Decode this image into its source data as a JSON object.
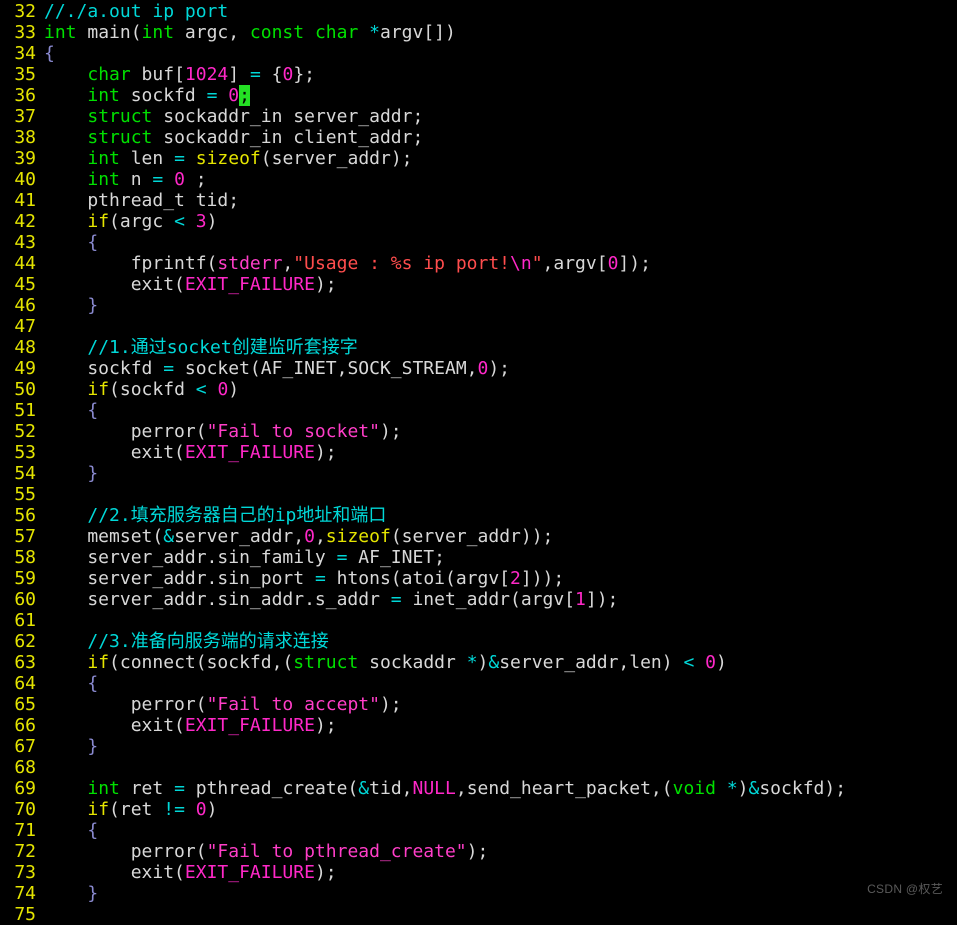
{
  "editor": {
    "background_color": "#000000",
    "default_text_color": "#d8d8d8",
    "gutter_color": "#e5e500",
    "cursor_color": "#24e024",
    "first_line_number": 32,
    "last_line_number": 75,
    "language": "C",
    "colors": {
      "comment": "#00d8d8",
      "type_keyword": "#00e000",
      "control_keyword": "#e5e500",
      "number": "#ff28c8",
      "string": "#ff4d4d",
      "string_alt": "#ff3ec8",
      "macro": "#ff28c8",
      "operator": "#00d8d8",
      "identifier": "#d8d8d8",
      "brace": "#8a8ad0",
      "watermark": "#5a5a5a"
    }
  },
  "watermark": {
    "text": "CSDN @权艺"
  },
  "lines": [
    {
      "num": "32",
      "tokens": [
        {
          "t": "//./a.out ip port",
          "c": "t-cmt"
        }
      ]
    },
    {
      "num": "33",
      "tokens": [
        {
          "t": "int",
          "c": "t-kw"
        },
        {
          "t": " main",
          "c": "t-id"
        },
        {
          "t": "(",
          "c": "t-punc"
        },
        {
          "t": "int",
          "c": "t-kw"
        },
        {
          "t": " argc, ",
          "c": "t-id"
        },
        {
          "t": "const",
          "c": "t-kw"
        },
        {
          "t": " ",
          "c": "t-id"
        },
        {
          "t": "char",
          "c": "t-kw"
        },
        {
          "t": " ",
          "c": "t-id"
        },
        {
          "t": "*",
          "c": "t-op"
        },
        {
          "t": "argv[])",
          "c": "t-id"
        }
      ]
    },
    {
      "num": "34",
      "tokens": [
        {
          "t": "{",
          "c": "t-brace"
        }
      ]
    },
    {
      "num": "35",
      "tokens": [
        {
          "t": "    ",
          "c": "t-id"
        },
        {
          "t": "char",
          "c": "t-kw"
        },
        {
          "t": " buf[",
          "c": "t-id"
        },
        {
          "t": "1024",
          "c": "t-num"
        },
        {
          "t": "] ",
          "c": "t-id"
        },
        {
          "t": "=",
          "c": "t-op"
        },
        {
          "t": " {",
          "c": "t-id"
        },
        {
          "t": "0",
          "c": "t-num"
        },
        {
          "t": "};",
          "c": "t-id"
        }
      ]
    },
    {
      "num": "36",
      "tokens": [
        {
          "t": "    ",
          "c": "t-id"
        },
        {
          "t": "int",
          "c": "t-kw"
        },
        {
          "t": " sockfd ",
          "c": "t-id"
        },
        {
          "t": "=",
          "c": "t-op"
        },
        {
          "t": " ",
          "c": "t-id"
        },
        {
          "t": "0",
          "c": "t-num"
        },
        {
          "t": ";",
          "c": "cursor"
        }
      ]
    },
    {
      "num": "37",
      "tokens": [
        {
          "t": "    ",
          "c": "t-id"
        },
        {
          "t": "struct",
          "c": "t-kw"
        },
        {
          "t": " sockaddr_in server_addr;",
          "c": "t-id"
        }
      ]
    },
    {
      "num": "38",
      "tokens": [
        {
          "t": "    ",
          "c": "t-id"
        },
        {
          "t": "struct",
          "c": "t-kw"
        },
        {
          "t": " sockaddr_in client_addr;",
          "c": "t-id"
        }
      ]
    },
    {
      "num": "39",
      "tokens": [
        {
          "t": "    ",
          "c": "t-id"
        },
        {
          "t": "int",
          "c": "t-kw"
        },
        {
          "t": " len ",
          "c": "t-id"
        },
        {
          "t": "=",
          "c": "t-op"
        },
        {
          "t": " ",
          "c": "t-id"
        },
        {
          "t": "sizeof",
          "c": "t-ctl"
        },
        {
          "t": "(server_addr);",
          "c": "t-id"
        }
      ]
    },
    {
      "num": "40",
      "tokens": [
        {
          "t": "    ",
          "c": "t-id"
        },
        {
          "t": "int",
          "c": "t-kw"
        },
        {
          "t": " n ",
          "c": "t-id"
        },
        {
          "t": "=",
          "c": "t-op"
        },
        {
          "t": " ",
          "c": "t-id"
        },
        {
          "t": "0",
          "c": "t-num"
        },
        {
          "t": " ;",
          "c": "t-id"
        }
      ]
    },
    {
      "num": "41",
      "tokens": [
        {
          "t": "    pthread_t tid;",
          "c": "t-id"
        }
      ]
    },
    {
      "num": "42",
      "tokens": [
        {
          "t": "    ",
          "c": "t-id"
        },
        {
          "t": "if",
          "c": "t-ctl"
        },
        {
          "t": "(argc ",
          "c": "t-id"
        },
        {
          "t": "<",
          "c": "t-op"
        },
        {
          "t": " ",
          "c": "t-id"
        },
        {
          "t": "3",
          "c": "t-num"
        },
        {
          "t": ")",
          "c": "t-id"
        }
      ]
    },
    {
      "num": "43",
      "tokens": [
        {
          "t": "    {",
          "c": "t-brace"
        }
      ]
    },
    {
      "num": "44",
      "tokens": [
        {
          "t": "        fprintf(",
          "c": "t-id"
        },
        {
          "t": "stderr",
          "c": "t-str2"
        },
        {
          "t": ",",
          "c": "t-id"
        },
        {
          "t": "\"Usage : %s ip port!",
          "c": "t-str"
        },
        {
          "t": "\\n",
          "c": "t-esc"
        },
        {
          "t": "\"",
          "c": "t-str"
        },
        {
          "t": ",argv[",
          "c": "t-id"
        },
        {
          "t": "0",
          "c": "t-num"
        },
        {
          "t": "]);",
          "c": "t-id"
        }
      ]
    },
    {
      "num": "45",
      "tokens": [
        {
          "t": "        exit(",
          "c": "t-id"
        },
        {
          "t": "EXIT_FAILURE",
          "c": "t-mac"
        },
        {
          "t": ");",
          "c": "t-id"
        }
      ]
    },
    {
      "num": "46",
      "tokens": [
        {
          "t": "    }",
          "c": "t-brace"
        }
      ]
    },
    {
      "num": "47",
      "tokens": []
    },
    {
      "num": "48",
      "tokens": [
        {
          "t": "    ",
          "c": "t-id"
        },
        {
          "t": "//1.通过socket创建监听套接字",
          "c": "t-cmt"
        }
      ]
    },
    {
      "num": "49",
      "tokens": [
        {
          "t": "    sockfd ",
          "c": "t-id"
        },
        {
          "t": "=",
          "c": "t-op"
        },
        {
          "t": " socket(AF_INET,SOCK_STREAM,",
          "c": "t-id"
        },
        {
          "t": "0",
          "c": "t-num"
        },
        {
          "t": ");",
          "c": "t-id"
        }
      ]
    },
    {
      "num": "50",
      "tokens": [
        {
          "t": "    ",
          "c": "t-id"
        },
        {
          "t": "if",
          "c": "t-ctl"
        },
        {
          "t": "(sockfd ",
          "c": "t-id"
        },
        {
          "t": "<",
          "c": "t-op"
        },
        {
          "t": " ",
          "c": "t-id"
        },
        {
          "t": "0",
          "c": "t-num"
        },
        {
          "t": ")",
          "c": "t-id"
        }
      ]
    },
    {
      "num": "51",
      "tokens": [
        {
          "t": "    {",
          "c": "t-brace"
        }
      ]
    },
    {
      "num": "52",
      "tokens": [
        {
          "t": "        perror(",
          "c": "t-id"
        },
        {
          "t": "\"Fail to socket\"",
          "c": "t-str2"
        },
        {
          "t": ");",
          "c": "t-id"
        }
      ]
    },
    {
      "num": "53",
      "tokens": [
        {
          "t": "        exit(",
          "c": "t-id"
        },
        {
          "t": "EXIT_FAILURE",
          "c": "t-mac"
        },
        {
          "t": ");",
          "c": "t-id"
        }
      ]
    },
    {
      "num": "54",
      "tokens": [
        {
          "t": "    }",
          "c": "t-brace"
        }
      ]
    },
    {
      "num": "55",
      "tokens": []
    },
    {
      "num": "56",
      "tokens": [
        {
          "t": "    ",
          "c": "t-id"
        },
        {
          "t": "//2.填充服务器自己的ip地址和端口",
          "c": "t-cmt"
        }
      ]
    },
    {
      "num": "57",
      "tokens": [
        {
          "t": "    memset(",
          "c": "t-id"
        },
        {
          "t": "&",
          "c": "t-op"
        },
        {
          "t": "server_addr,",
          "c": "t-id"
        },
        {
          "t": "0",
          "c": "t-num"
        },
        {
          "t": ",",
          "c": "t-id"
        },
        {
          "t": "sizeof",
          "c": "t-ctl"
        },
        {
          "t": "(server_addr));",
          "c": "t-id"
        }
      ]
    },
    {
      "num": "58",
      "tokens": [
        {
          "t": "    server_addr.sin_family ",
          "c": "t-id"
        },
        {
          "t": "=",
          "c": "t-op"
        },
        {
          "t": " AF_INET;",
          "c": "t-id"
        }
      ]
    },
    {
      "num": "59",
      "tokens": [
        {
          "t": "    server_addr.sin_port ",
          "c": "t-id"
        },
        {
          "t": "=",
          "c": "t-op"
        },
        {
          "t": " htons(atoi(argv[",
          "c": "t-id"
        },
        {
          "t": "2",
          "c": "t-num"
        },
        {
          "t": "]));",
          "c": "t-id"
        }
      ]
    },
    {
      "num": "60",
      "tokens": [
        {
          "t": "    server_addr.sin_addr.s_addr ",
          "c": "t-id"
        },
        {
          "t": "=",
          "c": "t-op"
        },
        {
          "t": " inet_addr(argv[",
          "c": "t-id"
        },
        {
          "t": "1",
          "c": "t-num"
        },
        {
          "t": "]);",
          "c": "t-id"
        }
      ]
    },
    {
      "num": "61",
      "tokens": []
    },
    {
      "num": "62",
      "tokens": [
        {
          "t": "    ",
          "c": "t-id"
        },
        {
          "t": "//3.准备向服务端的请求连接",
          "c": "t-cmt"
        }
      ]
    },
    {
      "num": "63",
      "tokens": [
        {
          "t": "    ",
          "c": "t-id"
        },
        {
          "t": "if",
          "c": "t-ctl"
        },
        {
          "t": "(connect(sockfd,(",
          "c": "t-id"
        },
        {
          "t": "struct",
          "c": "t-kw"
        },
        {
          "t": " sockaddr ",
          "c": "t-id"
        },
        {
          "t": "*",
          "c": "t-op"
        },
        {
          "t": ")",
          "c": "t-id"
        },
        {
          "t": "&",
          "c": "t-op"
        },
        {
          "t": "server_addr,len) ",
          "c": "t-id"
        },
        {
          "t": "<",
          "c": "t-op"
        },
        {
          "t": " ",
          "c": "t-id"
        },
        {
          "t": "0",
          "c": "t-num"
        },
        {
          "t": ")",
          "c": "t-id"
        }
      ]
    },
    {
      "num": "64",
      "tokens": [
        {
          "t": "    {",
          "c": "t-brace"
        }
      ]
    },
    {
      "num": "65",
      "tokens": [
        {
          "t": "        perror(",
          "c": "t-id"
        },
        {
          "t": "\"Fail to accept\"",
          "c": "t-str2"
        },
        {
          "t": ");",
          "c": "t-id"
        }
      ]
    },
    {
      "num": "66",
      "tokens": [
        {
          "t": "        exit(",
          "c": "t-id"
        },
        {
          "t": "EXIT_FAILURE",
          "c": "t-mac"
        },
        {
          "t": ");",
          "c": "t-id"
        }
      ]
    },
    {
      "num": "67",
      "tokens": [
        {
          "t": "    }",
          "c": "t-brace"
        }
      ]
    },
    {
      "num": "68",
      "tokens": []
    },
    {
      "num": "69",
      "tokens": [
        {
          "t": "    ",
          "c": "t-id"
        },
        {
          "t": "int",
          "c": "t-kw"
        },
        {
          "t": " ret ",
          "c": "t-id"
        },
        {
          "t": "=",
          "c": "t-op"
        },
        {
          "t": " pthread_create(",
          "c": "t-id"
        },
        {
          "t": "&",
          "c": "t-op"
        },
        {
          "t": "tid,",
          "c": "t-id"
        },
        {
          "t": "NULL",
          "c": "t-mac"
        },
        {
          "t": ",send_heart_packet,(",
          "c": "t-id"
        },
        {
          "t": "void",
          "c": "t-kw"
        },
        {
          "t": " ",
          "c": "t-id"
        },
        {
          "t": "*",
          "c": "t-op"
        },
        {
          "t": ")",
          "c": "t-id"
        },
        {
          "t": "&",
          "c": "t-op"
        },
        {
          "t": "sockfd);",
          "c": "t-id"
        }
      ]
    },
    {
      "num": "70",
      "tokens": [
        {
          "t": "    ",
          "c": "t-id"
        },
        {
          "t": "if",
          "c": "t-ctl"
        },
        {
          "t": "(ret ",
          "c": "t-id"
        },
        {
          "t": "!=",
          "c": "t-op"
        },
        {
          "t": " ",
          "c": "t-id"
        },
        {
          "t": "0",
          "c": "t-num"
        },
        {
          "t": ")",
          "c": "t-id"
        }
      ]
    },
    {
      "num": "71",
      "tokens": [
        {
          "t": "    {",
          "c": "t-brace"
        }
      ]
    },
    {
      "num": "72",
      "tokens": [
        {
          "t": "        perror(",
          "c": "t-id"
        },
        {
          "t": "\"Fail to pthread_create\"",
          "c": "t-str2"
        },
        {
          "t": ");",
          "c": "t-id"
        }
      ]
    },
    {
      "num": "73",
      "tokens": [
        {
          "t": "        exit(",
          "c": "t-id"
        },
        {
          "t": "EXIT_FAILURE",
          "c": "t-mac"
        },
        {
          "t": ");",
          "c": "t-id"
        }
      ]
    },
    {
      "num": "74",
      "tokens": [
        {
          "t": "    }",
          "c": "t-brace"
        }
      ]
    },
    {
      "num": "75",
      "tokens": []
    }
  ]
}
